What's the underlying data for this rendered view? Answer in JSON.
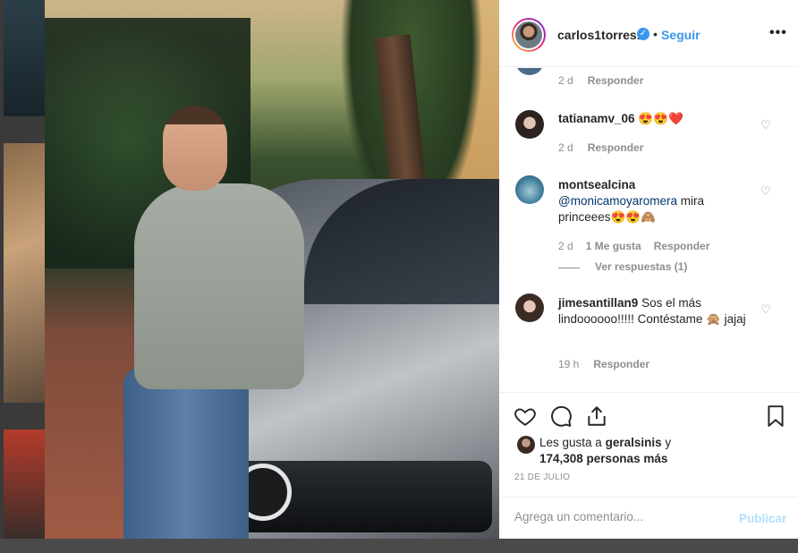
{
  "post": {
    "username": "carlos1torres1",
    "verified_icon": "verified-badge-icon",
    "separator": "•",
    "follow_label": "Seguir",
    "more_icon": "more-options-icon"
  },
  "comments": [
    {
      "username": "",
      "text": "",
      "time": "2 d",
      "likes": "",
      "reply": "Responder"
    },
    {
      "username": "tatianamv_06",
      "text": "😍😍❤️",
      "time": "2 d",
      "likes": "",
      "reply": "Responder"
    },
    {
      "username": "montsealcina",
      "mention": "@monicamoyaromera",
      "text": "mira princeees😍😍🙈",
      "time": "2 d",
      "likes": "1 Me gusta",
      "reply": "Responder",
      "view_replies": "Ver respuestas (1)"
    },
    {
      "username": "jimesantillan9",
      "text": "Sos el más lindoooooo!!!!! Contéstame 🙊 jajaj",
      "time": "19 h",
      "likes": "",
      "reply": "Responder"
    }
  ],
  "actions": {
    "like_icon": "heart-icon",
    "comment_icon": "comment-icon",
    "share_icon": "share-icon",
    "save_icon": "bookmark-icon"
  },
  "likes": {
    "prefix": "Les gusta a",
    "user": "geralsinis",
    "conj": "y",
    "count": "174,308 personas más"
  },
  "date": "21 DE JULIO",
  "comment_box": {
    "placeholder": "Agrega un comentario...",
    "publish_label": "Publicar"
  },
  "colors": {
    "accent": "#3897f0",
    "publish_disabled": "#b2dffc",
    "heart_red": "#c2185b"
  }
}
